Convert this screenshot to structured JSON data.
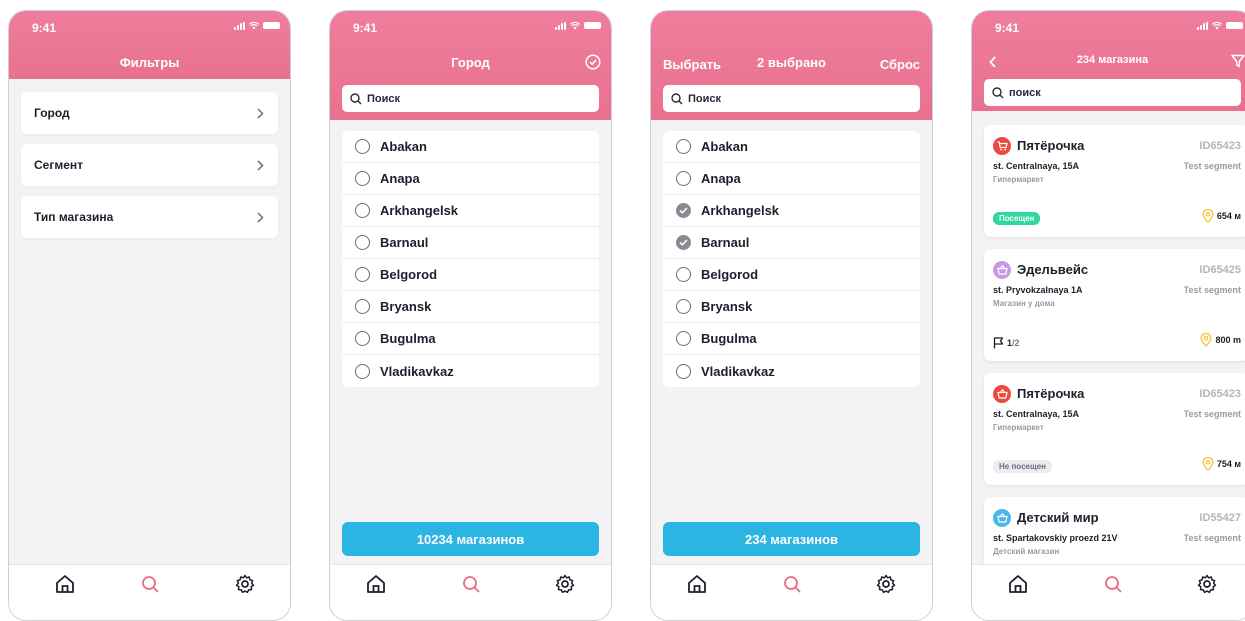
{
  "colors": {
    "header": "#ea7593",
    "accent": "#2bb5e3",
    "active_tab": "#e86a8a",
    "visited": "#33d69f"
  },
  "status_time": "9:41",
  "screen1": {
    "title": "Фильтры",
    "items": [
      {
        "label": "Город"
      },
      {
        "label": "Сегмент"
      },
      {
        "label": "Тип магазина"
      }
    ]
  },
  "screen2": {
    "title": "Город",
    "search_placeholder": "Поиск",
    "cities": [
      "Abakan",
      "Anapa",
      "Arkhangelsk",
      "Barnaul",
      "Belgorod",
      "Bryansk",
      "Bugulma",
      "Vladikavkaz"
    ],
    "button_label": "10234 магазинов"
  },
  "screen3": {
    "left_action": "Выбрать",
    "title": "2 выбрано",
    "right_action": "Сброс",
    "search_placeholder": "Поиск",
    "cities": [
      {
        "name": "Abakan",
        "checked": false
      },
      {
        "name": "Anapa",
        "checked": false
      },
      {
        "name": "Arkhangelsk",
        "checked": true
      },
      {
        "name": "Barnaul",
        "checked": true
      },
      {
        "name": "Belgorod",
        "checked": false
      },
      {
        "name": "Bryansk",
        "checked": false
      },
      {
        "name": "Bugulma",
        "checked": false
      },
      {
        "name": "Vladikavkaz",
        "checked": false
      }
    ],
    "button_label": "234 магазинов"
  },
  "screen4": {
    "title": "234 магазина",
    "search_placeholder": "поиск",
    "stores": [
      {
        "name": "Пятёрочка",
        "id": "ID65423",
        "address": "st. Centralnaya, 15A",
        "segment": "Test segment",
        "type": "Гипермаркет",
        "badge": "Посещен",
        "distance": "654 м",
        "icon_color": "#f0483e"
      },
      {
        "name": "Эдельвейс",
        "id": "ID65425",
        "address": "st. Pryvokzalnaya 1A",
        "segment": "Test segment",
        "type": "Магазин у дома",
        "progress": "1",
        "progress_total": "/2",
        "distance": "800 m",
        "icon_color": "#c89ae6"
      },
      {
        "name": "Пятёрочка",
        "id": "ID65423",
        "address": "st. Centralnaya, 15A",
        "segment": "Test segment",
        "type": "Гипермаркет",
        "badge": "Не посещен",
        "distance": "754 м",
        "icon_color": "#f0483e"
      },
      {
        "name": "Детский мир",
        "id": "ID55427",
        "address": "st. Spartakovskiy proezd 21V",
        "segment": "Test segment",
        "type": "Детский магазин",
        "icon_color": "#4ab7ea"
      }
    ]
  }
}
